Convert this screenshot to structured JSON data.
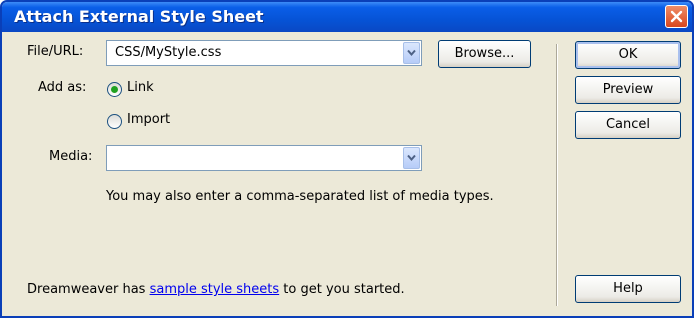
{
  "window": {
    "title": "Attach External Style Sheet"
  },
  "file": {
    "label": "File/URL:",
    "value": "CSS/MyStyle.css",
    "browse_label": "Browse..."
  },
  "addas": {
    "label": "Add as:",
    "options": [
      {
        "label": "Link",
        "selected": true
      },
      {
        "label": "Import",
        "selected": false
      }
    ]
  },
  "media": {
    "label": "Media:",
    "value": "",
    "hint": "You may also enter a comma-separated list of media types."
  },
  "buttons": {
    "ok": "OK",
    "preview": "Preview",
    "cancel": "Cancel",
    "help": "Help"
  },
  "footer": {
    "prefix": "Dreamweaver has ",
    "link": "sample style sheets",
    "suffix": " to get you started."
  },
  "colors": {
    "titlebar": "#0653d6",
    "dialog_bg": "#ece9d8",
    "link": "#0000ee",
    "radio_dot": "#21a121"
  },
  "icons": [
    "close-icon",
    "chevron-down-icon",
    "radio-selected-icon",
    "radio-unselected-icon"
  ]
}
